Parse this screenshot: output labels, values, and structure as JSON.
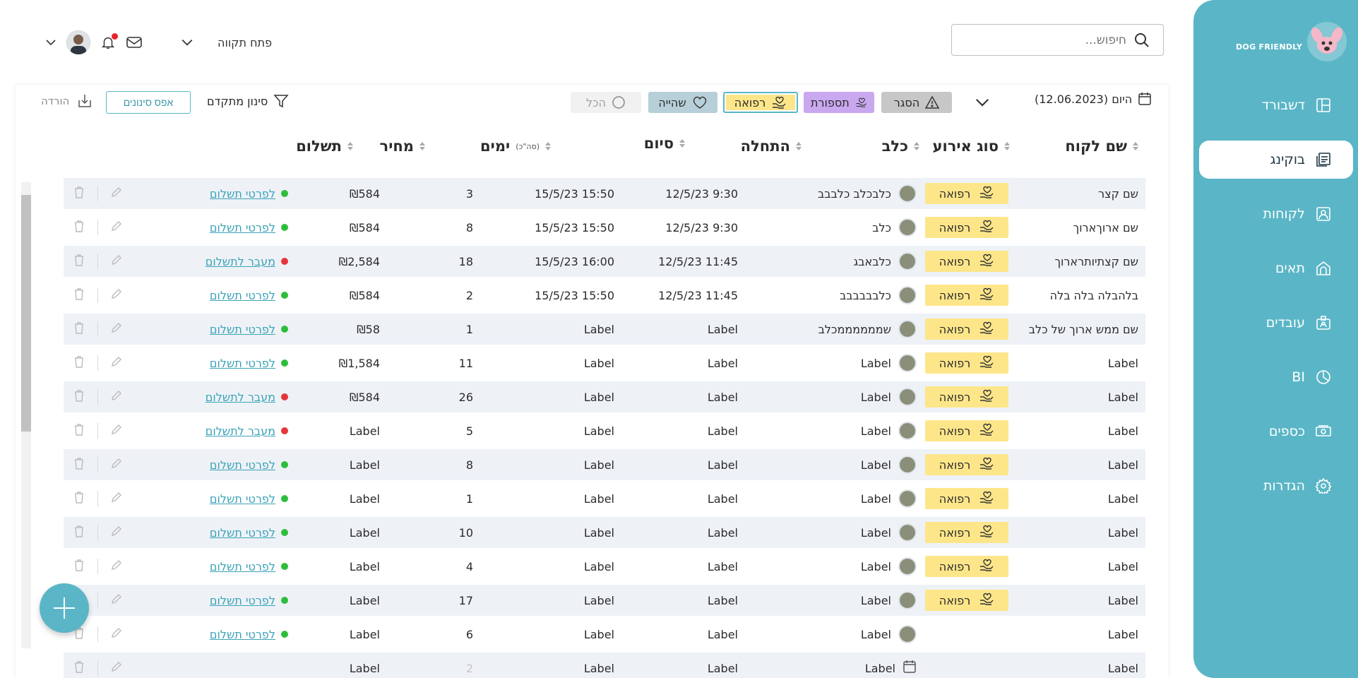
{
  "brand": {
    "name": "DOG FRIENDLY"
  },
  "nav": [
    {
      "label": "דשבורד",
      "icon": "dashboard-icon"
    },
    {
      "label": "בוקינג",
      "icon": "booking-icon",
      "active": true
    },
    {
      "label": "לקוחות",
      "icon": "customers-icon"
    },
    {
      "label": "תאים",
      "icon": "kennel-icon"
    },
    {
      "label": "עובדים",
      "icon": "staff-icon"
    },
    {
      "label": "BI",
      "icon": "pie-chart-icon"
    },
    {
      "label": "כספים",
      "icon": "money-icon"
    },
    {
      "label": "הגדרות",
      "icon": "gear-icon"
    }
  ],
  "header": {
    "search_placeholder": "חיפוש...",
    "user_name": "פתח תקווה"
  },
  "filters": {
    "date": "היום (12.06.2023)",
    "chips": {
      "closed": "הסגר",
      "grooming": "תספורת",
      "medical": "רפואה",
      "stay": "שהייה",
      "all": "הכל"
    },
    "advanced": "סינון מתקדם",
    "reset": "אפס סינונים",
    "download": "הורדה"
  },
  "table": {
    "headers": {
      "customer": "שם לקוח",
      "event_type": "סוג אירוע",
      "dog": "כלב",
      "start": "התחלה",
      "end": "סיום",
      "days": "ימים",
      "days_note": "(סה\"כ)",
      "price": "מחיר",
      "payment": "תשלום"
    },
    "rows": [
      {
        "customer": "שם קצר",
        "type": "רפואה",
        "dog": "כלבכלב כלבבב",
        "start": "12/5/23 9:30",
        "end": "15/5/23 15:50",
        "days": "3",
        "price": "₪584",
        "pay": "לפרטי תשלום",
        "status": "green"
      },
      {
        "customer": "שם ארוךארוך",
        "type": "רפואה",
        "dog": "כלב",
        "start": "12/5/23 9:30",
        "end": "15/5/23 15:50",
        "days": "8",
        "price": "₪584",
        "pay": "לפרטי תשלום",
        "status": "green"
      },
      {
        "customer": "שם קצתיותרארוך",
        "type": "רפואה",
        "dog": "כלבאבג",
        "start": "12/5/23 11:45",
        "end": "15/5/23 16:00",
        "days": "18",
        "price": "₪2,584",
        "pay": "מעבר לתשלום",
        "status": "red"
      },
      {
        "customer": "בלהבלה בלה בלה",
        "type": "רפואה",
        "dog": "כלבבבבבב",
        "start": "12/5/23 11:45",
        "end": "15/5/23 15:50",
        "days": "2",
        "price": "₪584",
        "pay": "לפרטי תשלום",
        "status": "green"
      },
      {
        "customer": "שם ממש ארוך של כלב",
        "type": "רפואה",
        "dog": "שממממממכלב",
        "start": "Label",
        "end": "Label",
        "days": "1",
        "price": "₪58",
        "pay": "לפרטי תשלום",
        "status": "green"
      },
      {
        "customer": "Label",
        "type": "רפואה",
        "dog": "Label",
        "start": "Label",
        "end": "Label",
        "days": "11",
        "price": "₪1,584",
        "pay": "לפרטי תשלום",
        "status": "green"
      },
      {
        "customer": "Label",
        "type": "רפואה",
        "dog": "Label",
        "start": "Label",
        "end": "Label",
        "days": "26",
        "price": "₪584",
        "pay": "מעבר לתשלום",
        "status": "red"
      },
      {
        "customer": "Label",
        "type": "רפואה",
        "dog": "Label",
        "start": "Label",
        "end": "Label",
        "days": "5",
        "price": "Label",
        "pay": "מעבר לתשלום",
        "status": "red"
      },
      {
        "customer": "Label",
        "type": "רפואה",
        "dog": "Label",
        "start": "Label",
        "end": "Label",
        "days": "8",
        "price": "Label",
        "pay": "לפרטי תשלום",
        "status": "green"
      },
      {
        "customer": "Label",
        "type": "רפואה",
        "dog": "Label",
        "start": "Label",
        "end": "Label",
        "days": "1",
        "price": "Label",
        "pay": "לפרטי תשלום",
        "status": "green"
      },
      {
        "customer": "Label",
        "type": "רפואה",
        "dog": "Label",
        "start": "Label",
        "end": "Label",
        "days": "10",
        "price": "Label",
        "pay": "לפרטי תשלום",
        "status": "green"
      },
      {
        "customer": "Label",
        "type": "רפואה",
        "dog": "Label",
        "start": "Label",
        "end": "Label",
        "days": "4",
        "price": "Label",
        "pay": "לפרטי תשלום",
        "status": "green"
      },
      {
        "customer": "Label",
        "type": "רפואה",
        "dog": "Label",
        "start": "Label",
        "end": "Label",
        "days": "17",
        "price": "Label",
        "pay": "לפרטי תשלום",
        "status": "green"
      },
      {
        "customer": "Label",
        "type": "",
        "dog": "Label",
        "start": "Label",
        "end": "Label",
        "days": "6",
        "price": "Label",
        "pay": "לפרטי תשלום",
        "status": "green"
      },
      {
        "customer": "Label",
        "type": "",
        "dog": "Label",
        "start": "Label",
        "end": "Label",
        "days": "2",
        "price": "Label",
        "pay": "",
        "status": "",
        "calendar": true
      }
    ]
  },
  "colors": {
    "accent": "#5ab6c6",
    "medical": "#fde68a",
    "grooming": "#c9a8f0",
    "closed": "#c7c7c7",
    "stay": "#b7cfd8",
    "green": "#2ebd3b",
    "red": "#e5353a"
  }
}
